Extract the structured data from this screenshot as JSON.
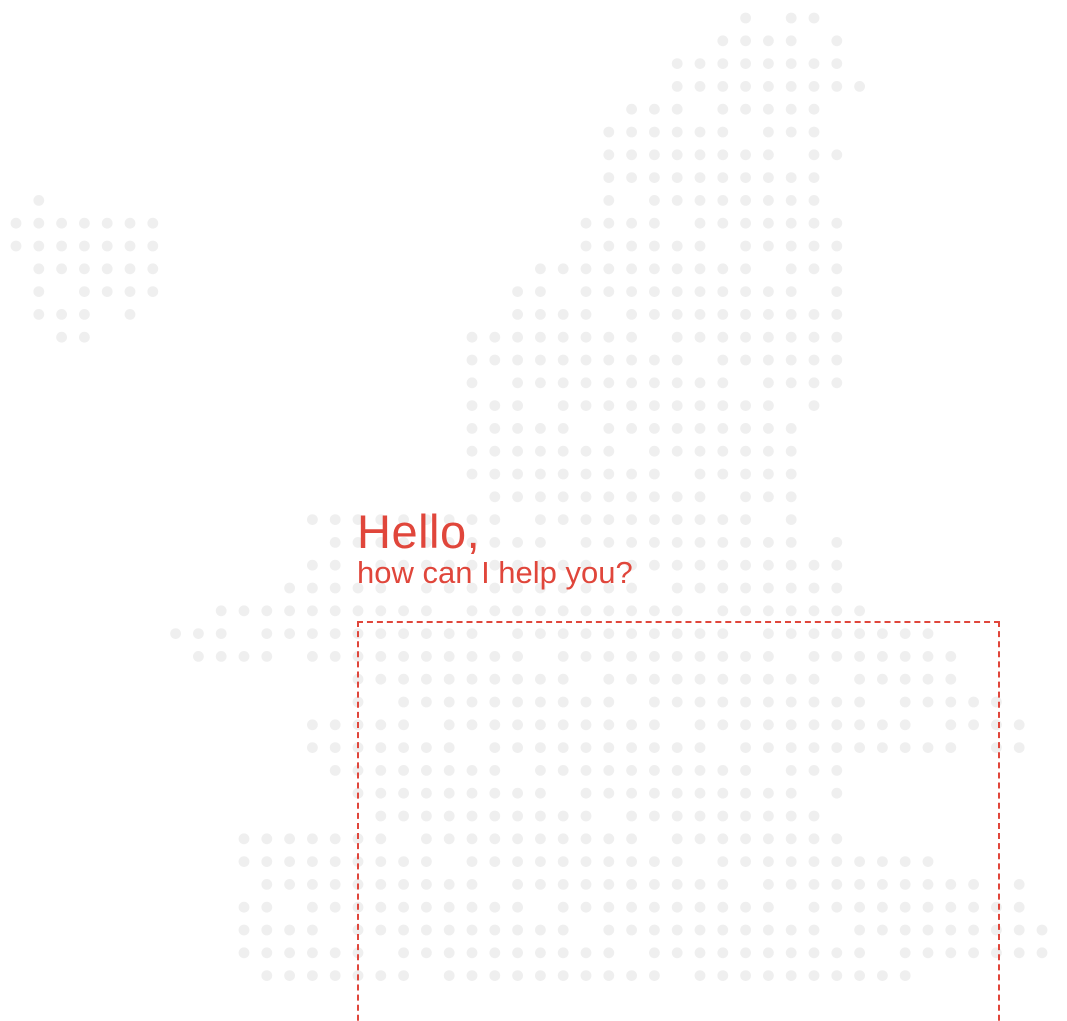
{
  "greeting": {
    "title": "Hello",
    "title_punct": ",",
    "subtitle": "how can I help you?"
  },
  "colors": {
    "accent": "#e0463b",
    "dot": "#efefef",
    "background": "#ffffff"
  },
  "icons": {
    "map": "europe-dot-map-icon"
  }
}
